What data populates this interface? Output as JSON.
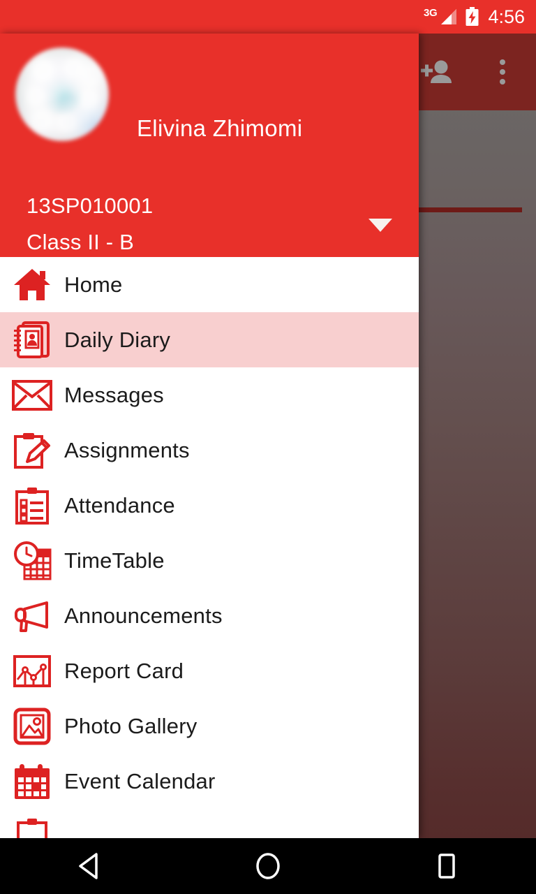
{
  "status_bar": {
    "network_type": "3G",
    "signal_icon": "signal-bars-icon",
    "battery_icon": "battery-charging-icon",
    "time": "4:56"
  },
  "app_bar": {
    "add_person_icon": "add-person-icon",
    "overflow_icon": "overflow-menu-icon"
  },
  "drawer": {
    "profile": {
      "avatar_icon": "avatar-photo",
      "name": "Elivina  Zhimomi",
      "student_id": "13SP010001",
      "class": "Class II - B",
      "expand_icon": "chevron-down-icon"
    },
    "items": [
      {
        "label": "Home",
        "icon": "home-icon",
        "selected": false
      },
      {
        "label": "Daily Diary",
        "icon": "contact-book-icon",
        "selected": true
      },
      {
        "label": "Messages",
        "icon": "envelope-icon",
        "selected": false
      },
      {
        "label": "Assignments",
        "icon": "clipboard-pencil-icon",
        "selected": false
      },
      {
        "label": "Attendance",
        "icon": "clipboard-check-icon",
        "selected": false
      },
      {
        "label": "TimeTable",
        "icon": "clock-calendar-icon",
        "selected": false
      },
      {
        "label": "Announcements",
        "icon": "megaphone-icon",
        "selected": false
      },
      {
        "label": "Report Card",
        "icon": "chart-report-icon",
        "selected": false
      },
      {
        "label": "Photo Gallery",
        "icon": "image-icon",
        "selected": false
      },
      {
        "label": "Event Calendar",
        "icon": "calendar-icon",
        "selected": false
      }
    ]
  },
  "navigation_bar": {
    "back_icon": "back-triangle-icon",
    "home_icon": "home-circle-icon",
    "recents_icon": "recents-square-icon"
  },
  "colors": {
    "primary_red": "#E8302A",
    "selected_row": "#F8CFCF",
    "icon_red": "#DD2222",
    "app_bar_dim": "#7C2420",
    "tab_indicator": "#6E1A17"
  }
}
